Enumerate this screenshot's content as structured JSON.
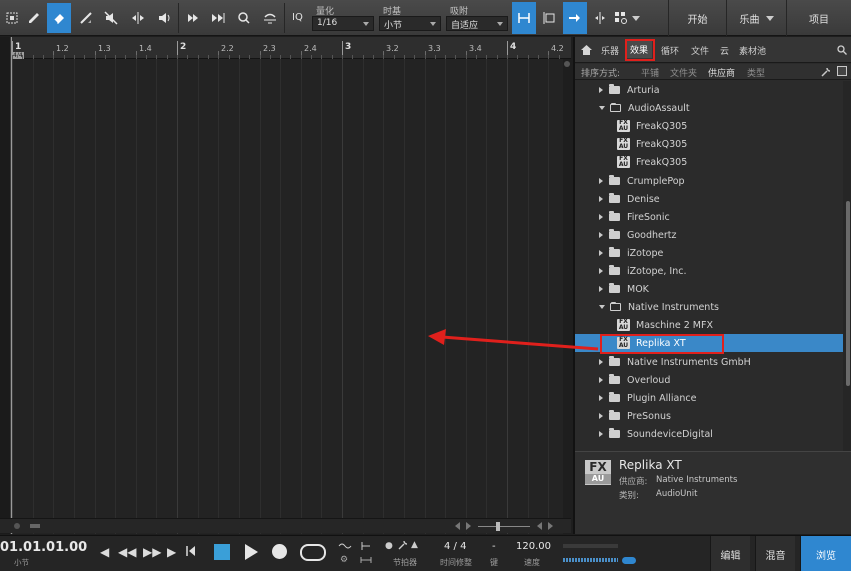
{
  "toolbar": {
    "iq_label": "IQ",
    "quantize_label": "量化",
    "quantize_value": "1/16",
    "timebase_label": "时基",
    "timebase_value": "小节",
    "snap_label": "吸附",
    "snap_value": "自适应",
    "nav": [
      "开始",
      "乐曲",
      "项目"
    ]
  },
  "ruler": {
    "time_signature": "4/4",
    "labels": [
      "1",
      "1.2",
      "1.3",
      "1.4",
      "2",
      "2.2",
      "2.3",
      "2.4",
      "3",
      "3.2",
      "3.3",
      "3.4",
      "4",
      "4.2"
    ]
  },
  "browser": {
    "tabs": [
      "乐器",
      "效果",
      "循环",
      "文件",
      "云",
      "素材池"
    ],
    "selected_tab": "效果",
    "sort_label": "排序方式:",
    "sort_options": [
      "平铺",
      "文件夹",
      "供应商",
      "类型"
    ],
    "selected_sort": "供应商",
    "tree": [
      {
        "label": "Arturia",
        "type": "folder",
        "expanded": false
      },
      {
        "label": "AudioAssault",
        "type": "folder",
        "expanded": true
      },
      {
        "label": "FreakQ305",
        "type": "plugin"
      },
      {
        "label": "FreakQ305",
        "type": "plugin"
      },
      {
        "label": "FreakQ305",
        "type": "plugin"
      },
      {
        "label": "CrumplePop",
        "type": "folder",
        "expanded": false
      },
      {
        "label": "Denise",
        "type": "folder",
        "expanded": false
      },
      {
        "label": "FireSonic",
        "type": "folder",
        "expanded": false
      },
      {
        "label": "Goodhertz",
        "type": "folder",
        "expanded": false
      },
      {
        "label": "iZotope",
        "type": "folder",
        "expanded": false
      },
      {
        "label": "iZotope, Inc.",
        "type": "folder",
        "expanded": false
      },
      {
        "label": "MOK",
        "type": "folder",
        "expanded": false
      },
      {
        "label": "Native Instruments",
        "type": "folder",
        "expanded": true
      },
      {
        "label": "Maschine 2 MFX",
        "type": "plugin"
      },
      {
        "label": "Replika XT",
        "type": "plugin",
        "selected": true
      },
      {
        "label": "Native Instruments GmbH",
        "type": "folder",
        "expanded": false
      },
      {
        "label": "Overloud",
        "type": "folder",
        "expanded": false
      },
      {
        "label": "Plugin Alliance",
        "type": "folder",
        "expanded": false
      },
      {
        "label": "PreSonus",
        "type": "folder",
        "expanded": false
      },
      {
        "label": "SoundeviceDigital",
        "type": "folder",
        "expanded": false
      }
    ],
    "fx_icon_top": "FX",
    "fx_icon_bottom": "AU",
    "info": {
      "badge_top": "FX",
      "badge_bottom": "AU",
      "title": "Replika XT",
      "vendor_label": "供应商:",
      "vendor": "Native Instruments",
      "type_label": "类别:",
      "type": "AudioUnit"
    }
  },
  "transport": {
    "position": "01.01.01.00",
    "position_sub": "小节",
    "metronome_label": "节拍器",
    "timesig_value": "4 / 4",
    "timesig_label": "时间修整",
    "key_value": "-",
    "key_label": "键",
    "tempo_value": "120.00",
    "tempo_label": "速度",
    "views": [
      "编辑",
      "混音",
      "浏览"
    ],
    "active_view": "浏览"
  },
  "colors": {
    "accent": "#2f87d0",
    "selection": "#3a88c8",
    "annotation": "#e0201c"
  }
}
